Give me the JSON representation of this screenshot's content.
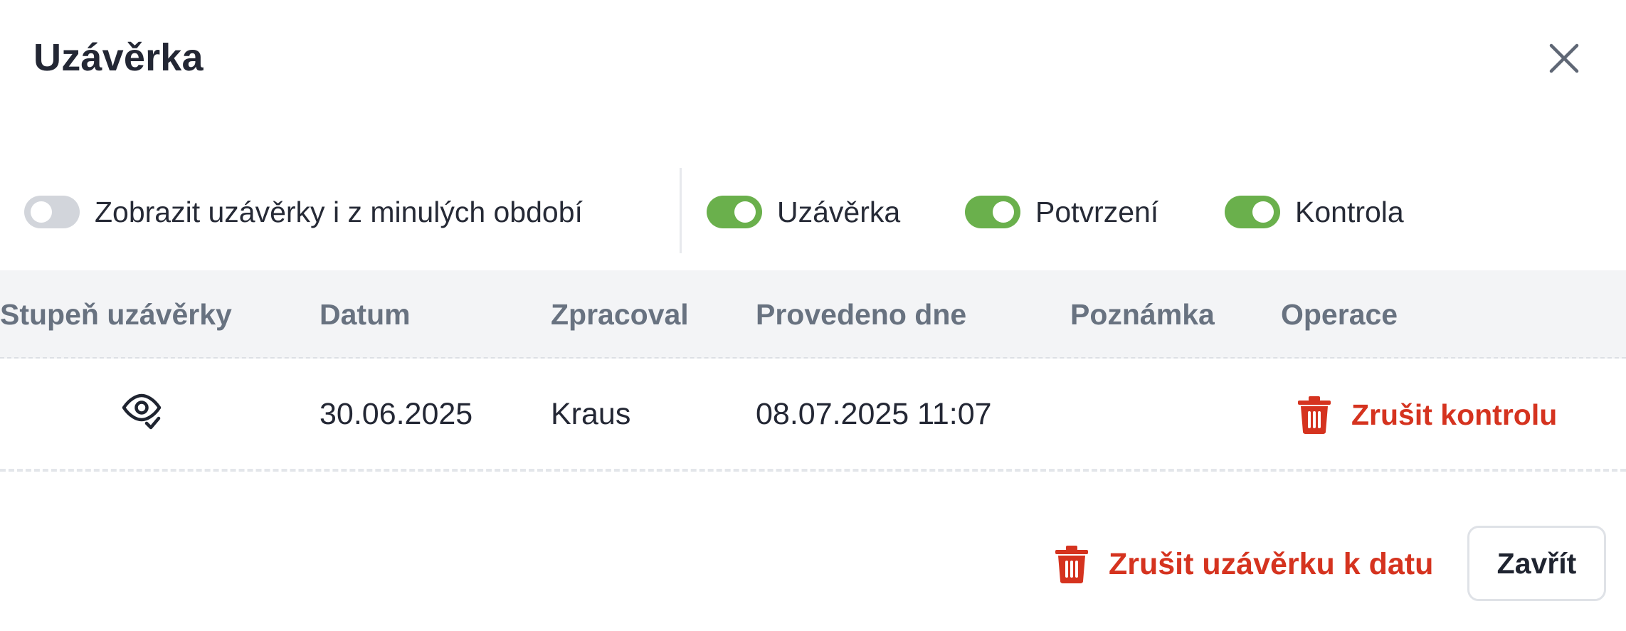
{
  "dialog": {
    "title": "Uzávěrka",
    "close_icon": "close-icon"
  },
  "filters": {
    "past_periods": {
      "label": "Zobrazit uzávěrky i z minulých období",
      "on": false
    },
    "uzaverka": {
      "label": "Uzávěrka",
      "on": true
    },
    "potvrzeni": {
      "label": "Potvrzení",
      "on": true
    },
    "kontrola": {
      "label": "Kontrola",
      "on": true
    }
  },
  "table": {
    "columns": [
      "Stupeň uzávěrky",
      "Datum",
      "Zpracoval",
      "Provedeno dne",
      "Poznámka",
      "Operace"
    ],
    "rows": [
      {
        "level_icon": "eye-check-icon",
        "date": "30.06.2025",
        "processed_by": "Kraus",
        "performed_on": "08.07.2025 11:07",
        "note": "",
        "operation": {
          "label": "Zrušit kontrolu",
          "icon": "trash-icon"
        }
      }
    ]
  },
  "footer": {
    "cancel_closing_label": "Zrušit uzávěrku k datu",
    "cancel_closing_icon": "trash-icon",
    "close_label": "Zavřít"
  },
  "colors": {
    "toggle_on": "#6ab04c",
    "toggle_off": "#d2d5db",
    "danger": "#d5331f",
    "header_bg": "#f3f4f6",
    "header_text": "#687280"
  }
}
